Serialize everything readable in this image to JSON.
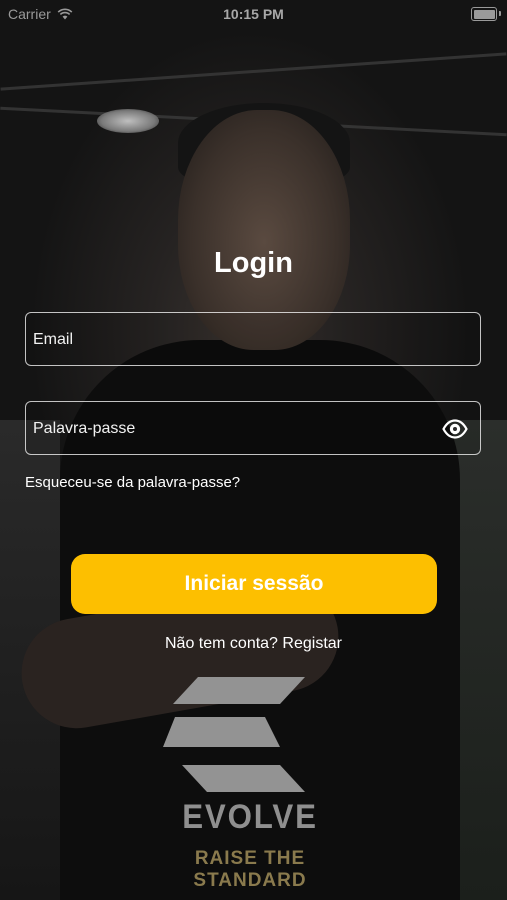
{
  "status_bar": {
    "carrier": "Carrier",
    "time": "10:15 PM"
  },
  "login": {
    "title": "Login",
    "email_placeholder": "Email",
    "password_placeholder": "Palavra-passe",
    "forgot_password": "Esqueceu-se da palavra-passe?",
    "submit_label": "Iniciar sessão",
    "signup_prompt": "Não tem conta?",
    "signup_link": "Registar"
  },
  "brand": {
    "name": "EVOLVE",
    "tagline": "RAISE THE STANDARD"
  },
  "colors": {
    "accent": "#fdbf00",
    "text": "#ffffff",
    "logo_gray": "#8f8f8f",
    "tagline_gold": "#8a7a4d"
  },
  "icons": {
    "wifi": "wifi-icon",
    "battery": "battery-icon",
    "eye": "eye-icon",
    "logo": "evolve-logo"
  }
}
